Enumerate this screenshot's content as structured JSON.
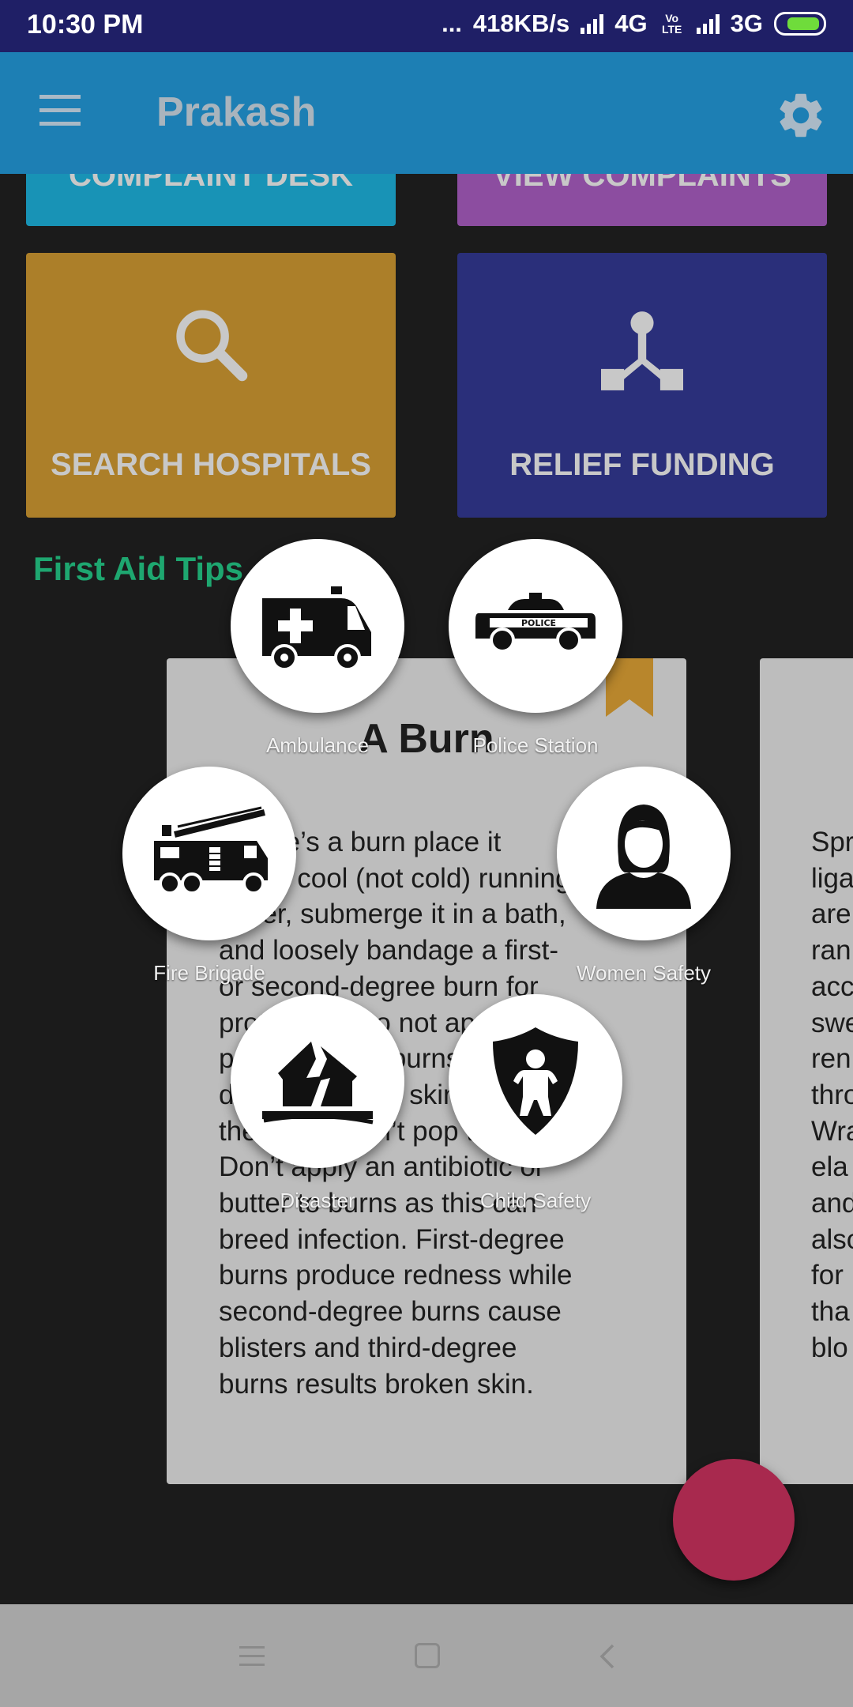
{
  "status_bar": {
    "time": "10:30 PM",
    "dots": "...",
    "speed": "418KB/s",
    "net1": "4G",
    "volte": "Vo LTE",
    "net2": "3G"
  },
  "app_bar": {
    "title": "Prakash"
  },
  "tiles": {
    "complaint_desk": "COMPLAINT DESK",
    "view_complaints": "VIEW COMPLAINTS",
    "search_hospitals": "SEARCH HOSPITALS",
    "relief_funding": "RELIEF FUNDING"
  },
  "section": {
    "title": "First Aid Tips"
  },
  "cards": [
    {
      "title": "A Burn",
      "lines": [
        "Where’s a burn place it",
        "under cool (not cold) running",
        "water, submerge it in a bath,",
        "and loosely bandage a first-",
        "or second-degree burn for",
        "protection. Do not apply",
        "pressure. For burns that",
        "don’t break the skin, or if",
        "there are, don’t pop them.",
        "Don’t apply an antibiotic or",
        "butter to burns as this can",
        "breed infection. First-degree",
        "burns produce redness while",
        "second-degree burns cause",
        "blisters and third-degree",
        "burns results broken skin."
      ]
    },
    {
      "lines": [
        "Spr",
        "liga",
        "are",
        "ran",
        "acc",
        "swe",
        "ren",
        "thro",
        "Wra",
        "ela",
        "and",
        "also",
        "for",
        "tha",
        "blo"
      ]
    }
  ],
  "emergency_menu": [
    {
      "label": "Ambulance",
      "icon": "ambulance-icon"
    },
    {
      "label": "Police Station",
      "icon": "police-car-icon"
    },
    {
      "label": "Fire Brigade",
      "icon": "fire-truck-icon"
    },
    {
      "label": "Women Safety",
      "icon": "woman-icon"
    },
    {
      "label": "Disaster",
      "icon": "earthquake-house-icon"
    },
    {
      "label": "Child Safety",
      "icon": "child-shield-icon"
    }
  ],
  "police_badge_text": "POLICE",
  "colors": {
    "status_bar": "#1f1f66",
    "app_bar": "#1d7fb4",
    "complaint_desk": "#1893b6",
    "view_complaints": "#8c4da0",
    "search_hospitals": "#ac7f29",
    "relief_funding": "#2a2f7a",
    "section_title": "#1ea770",
    "fab": "#a8294e"
  }
}
